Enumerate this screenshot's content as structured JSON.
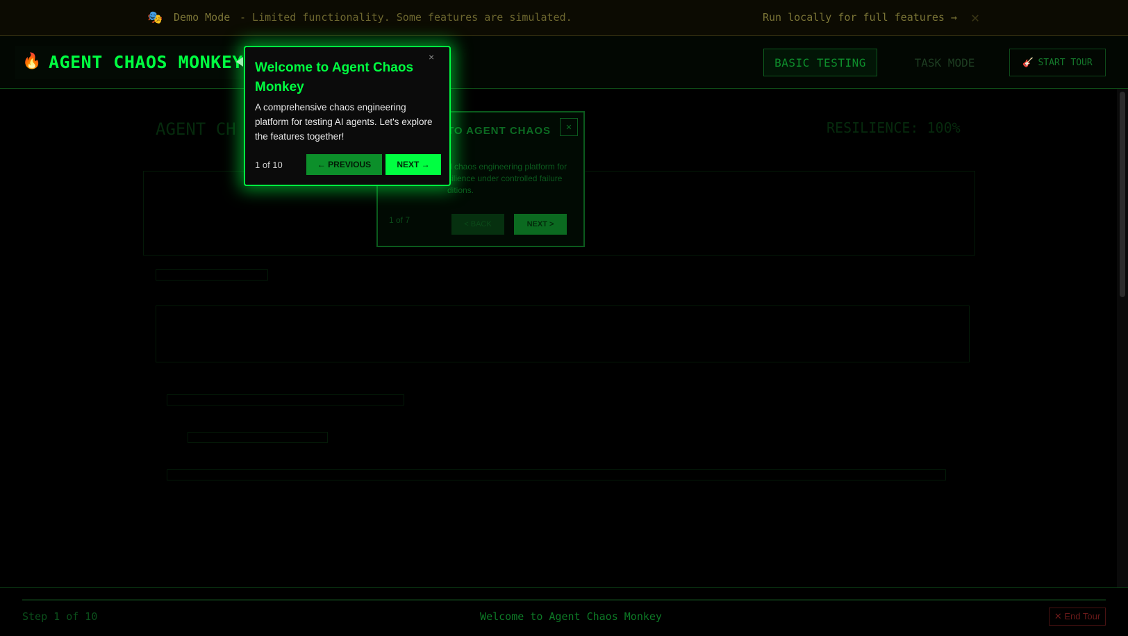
{
  "banner": {
    "icon": "🎭",
    "mode_label": "Demo Mode",
    "description": "- Limited functionality. Some features are simulated.",
    "run_link": "Run locally for full features →",
    "close_glyph": "✕"
  },
  "header": {
    "logo_icon": "🔥",
    "logo_text": "AGENT CHAOS MONKEY",
    "nav": {
      "basic_testing": "BASIC TESTING",
      "task_mode": "TASK MODE",
      "start_tour_icon": "🎸",
      "start_tour": "START TOUR"
    }
  },
  "background": {
    "title": "AGENT CH",
    "resilience": "RESILIENCE: 100%"
  },
  "secondary_tour": {
    "title": "TO AGENT CHAOS",
    "close_glyph": "✕",
    "body": "d chaos engineering platform for silience under controlled failure ditions.",
    "count": "1 of 7",
    "back_label": "< BACK",
    "next_label": "NEXT >"
  },
  "tour": {
    "title": "Welcome to Agent Chaos Monkey",
    "close_glyph": "×",
    "body": "A comprehensive chaos engineering platform for testing AI agents. Let's explore the features together!",
    "count": "1 of 10",
    "prev_label": "← PREVIOUS",
    "next_label": "NEXT →"
  },
  "footer": {
    "step_text": "Step 1 of 10",
    "step_title": "Welcome to Agent Chaos Monkey",
    "end_tour": "✕ End Tour"
  },
  "colors": {
    "accent": "#00ff41",
    "background": "#000000",
    "danger": "#6a1a1a"
  }
}
